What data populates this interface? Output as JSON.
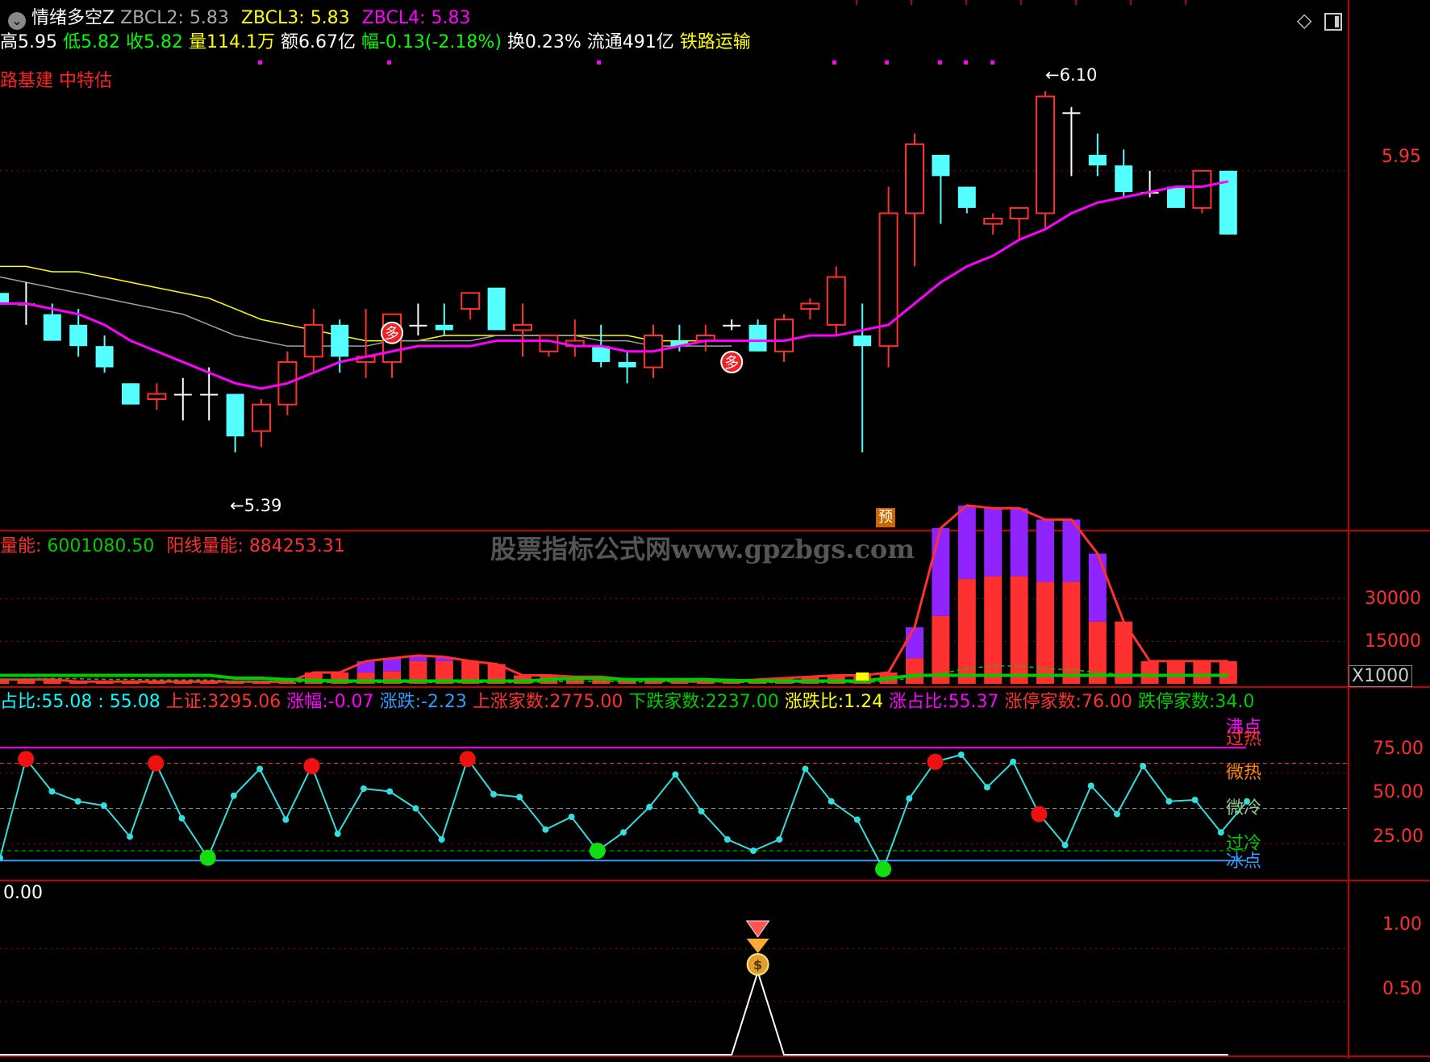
{
  "colors": {
    "up": "#ff3030",
    "down": "#54ffff",
    "ma_main": "#ff00ff",
    "ma_yellow": "#ffff00",
    "ma_gray": "#a0a0a0",
    "grid": "#b00000",
    "border": "#c00000",
    "green": "#00cc00",
    "purple": "#8f24ff",
    "cyan": "#00e5e5"
  },
  "header": {
    "indicator_name": "情绪多空Z",
    "zbcl2_label": "ZBCL2:",
    "zbcl2_value": "5.83",
    "zbcl3_label": "ZBCL3:",
    "zbcl3_value": "5.83",
    "zbcl4_label": "ZBCL4:",
    "zbcl4_value": "5.83",
    "high": "高5.95",
    "low": "低5.82",
    "close": "收5.82",
    "volume": "量114.1万",
    "amount": "额6.67亿",
    "change": "幅-0.13(-2.18%)",
    "turnover": "换0.23%",
    "float": "流通491亿",
    "sector": "铁路运输",
    "tags": "路基建 中特估",
    "collapse_icon": "chevron-down-icon",
    "diamond_icon": "diamond-icon",
    "window_icon": "window-toggle-icon"
  },
  "price_panel": {
    "y_axis_label": "5.95",
    "high_marker": "6.10",
    "low_marker": "5.39",
    "signal_label": "多",
    "forecast_label": "预"
  },
  "volume_panel": {
    "neg_label": "量能:",
    "neg_value": "6001080.50",
    "pos_label": "阳线量能:",
    "pos_value": "884253.31",
    "watermark": "股票指标公式网www.gpzbgs.com",
    "y_labels": [
      "30000",
      "15000"
    ],
    "multiplier": "X1000"
  },
  "sentiment_panel": {
    "ratio_label": "占比:",
    "ratio_value": "55.08",
    "ratio_value2": ": 55.08",
    "sh_label": "上证:",
    "sh_value": "3295.06",
    "chg_label": "涨幅:",
    "chg_value": "-0.07",
    "updown_label": "涨跌:",
    "updown_value": "-2.23",
    "up_count_label": "上涨家数:",
    "up_count_value": "2775.00",
    "down_count_label": "下跌家数:",
    "down_count_value": "2237.00",
    "ud_ratio_label": "涨跌比:",
    "ud_ratio_value": "1.24",
    "up_share_label": "涨占比:",
    "up_share_value": "55.37",
    "limit_up_label": "涨停家数:",
    "limit_up_value": "76.00",
    "limit_down_label": "跌停家数:",
    "limit_down_value": "34.0",
    "zone_labels": [
      "沸点",
      "过热",
      "微热",
      "微冷",
      "过冷",
      "冰点"
    ],
    "y_labels": [
      "75.00",
      "50.00",
      "25.00"
    ]
  },
  "signal_panel": {
    "value": "0.00",
    "y_labels": [
      "1.00",
      "0.50"
    ],
    "signal_icon": "money-bag-icon"
  },
  "chart_data": [
    {
      "type": "candlestick",
      "title": "情绪多空Z",
      "ylim": [
        5.3,
        6.15
      ],
      "candles": [
        [
          5.72,
          5.72,
          5.7,
          5.7
        ],
        [
          5.7,
          5.74,
          5.66,
          5.7
        ],
        [
          5.68,
          5.7,
          5.63,
          5.63
        ],
        [
          5.66,
          5.69,
          5.6,
          5.62
        ],
        [
          5.62,
          5.64,
          5.57,
          5.58
        ],
        [
          5.55,
          5.55,
          5.51,
          5.51
        ],
        [
          5.52,
          5.55,
          5.5,
          5.53
        ],
        [
          5.53,
          5.56,
          5.48,
          5.53
        ],
        [
          5.53,
          5.58,
          5.48,
          5.53
        ],
        [
          5.53,
          5.53,
          5.42,
          5.45
        ],
        [
          5.46,
          5.52,
          5.43,
          5.51
        ],
        [
          5.51,
          5.61,
          5.49,
          5.59
        ],
        [
          5.6,
          5.69,
          5.57,
          5.66
        ],
        [
          5.66,
          5.67,
          5.57,
          5.6
        ],
        [
          5.59,
          5.69,
          5.56,
          5.6
        ],
        [
          5.59,
          5.68,
          5.56,
          5.68
        ],
        [
          5.66,
          5.7,
          5.64,
          5.66
        ],
        [
          5.66,
          5.7,
          5.64,
          5.65
        ],
        [
          5.69,
          5.72,
          5.67,
          5.72
        ],
        [
          5.73,
          5.73,
          5.65,
          5.65
        ],
        [
          5.65,
          5.7,
          5.6,
          5.66
        ],
        [
          5.61,
          5.64,
          5.6,
          5.64
        ],
        [
          5.62,
          5.67,
          5.6,
          5.63
        ],
        [
          5.62,
          5.66,
          5.58,
          5.59
        ],
        [
          5.59,
          5.61,
          5.55,
          5.58
        ],
        [
          5.58,
          5.66,
          5.56,
          5.64
        ],
        [
          5.63,
          5.66,
          5.61,
          5.62
        ],
        [
          5.63,
          5.66,
          5.61,
          5.64
        ],
        [
          5.66,
          5.67,
          5.65,
          5.66
        ],
        [
          5.66,
          5.67,
          5.61,
          5.61
        ],
        [
          5.61,
          5.68,
          5.59,
          5.67
        ],
        [
          5.69,
          5.71,
          5.67,
          5.7
        ],
        [
          5.66,
          5.77,
          5.64,
          5.75
        ],
        [
          5.64,
          5.7,
          5.42,
          5.62
        ],
        [
          5.62,
          5.92,
          5.58,
          5.87
        ],
        [
          5.87,
          6.02,
          5.77,
          6.0
        ],
        [
          5.98,
          5.98,
          5.85,
          5.94
        ],
        [
          5.92,
          5.92,
          5.87,
          5.88
        ],
        [
          5.85,
          5.87,
          5.83,
          5.86
        ],
        [
          5.86,
          5.88,
          5.82,
          5.88
        ],
        [
          5.87,
          6.1,
          5.84,
          6.09
        ],
        [
          6.06,
          6.07,
          5.94,
          6.06
        ],
        [
          5.98,
          6.02,
          5.94,
          5.96
        ],
        [
          5.96,
          5.99,
          5.9,
          5.91
        ],
        [
          5.91,
          5.95,
          5.9,
          5.91
        ],
        [
          5.92,
          5.92,
          5.9,
          5.88
        ],
        [
          5.88,
          5.95,
          5.87,
          5.95
        ],
        [
          5.95,
          5.95,
          5.83,
          5.83
        ]
      ],
      "ma_main": [
        5.7,
        5.7,
        5.69,
        5.68,
        5.66,
        5.63,
        5.61,
        5.59,
        5.57,
        5.55,
        5.54,
        5.55,
        5.57,
        5.59,
        5.6,
        5.61,
        5.62,
        5.62,
        5.62,
        5.63,
        5.63,
        5.63,
        5.62,
        5.62,
        5.61,
        5.61,
        5.62,
        5.63,
        5.63,
        5.63,
        5.63,
        5.64,
        5.64,
        5.65,
        5.66,
        5.7,
        5.74,
        5.77,
        5.79,
        5.82,
        5.84,
        5.87,
        5.89,
        5.9,
        5.91,
        5.92,
        5.92,
        5.93
      ],
      "ma_gray": [
        5.75,
        5.74,
        5.73,
        5.72,
        5.71,
        5.7,
        5.69,
        5.68,
        5.66,
        5.64,
        5.63,
        5.62,
        5.62,
        5.62,
        5.62,
        5.63,
        5.63,
        5.63,
        5.63,
        5.64,
        5.64,
        5.64,
        5.64,
        5.63,
        5.63,
        5.62,
        5.62,
        5.62,
        5.62
      ],
      "ma_yellow": [
        5.77,
        5.77,
        5.76,
        5.76,
        5.75,
        5.74,
        5.73,
        5.72,
        5.71,
        5.69,
        5.67,
        5.66,
        5.65,
        5.64,
        5.63,
        5.63,
        5.63,
        5.64,
        5.64,
        5.64,
        5.64,
        5.64,
        5.64,
        5.64,
        5.64,
        5.63,
        5.63,
        5.63,
        5.63
      ],
      "signals": [
        {
          "index": 15,
          "label": "多"
        },
        {
          "index": 28,
          "label": "多"
        }
      ]
    },
    {
      "type": "bar",
      "title": "量能",
      "ylim": [
        0,
        45000
      ],
      "red": [
        1500,
        1500,
        1500,
        800,
        800,
        800,
        800,
        800,
        800,
        800,
        800,
        600,
        4000,
        4000,
        4000,
        4500,
        8000,
        8000,
        8000,
        7000,
        3000,
        3000,
        2500,
        2500,
        1500,
        1500,
        800,
        800,
        1000,
        1500,
        2000,
        2500,
        3000,
        3000,
        4000,
        9000,
        24000,
        37000,
        38000,
        38000,
        36000,
        36000,
        22000,
        22000,
        8000,
        8000,
        8000,
        8000
      ],
      "purple": [
        0,
        0,
        0,
        0,
        0,
        0,
        0,
        0,
        0,
        0,
        0,
        0,
        0,
        0,
        4000,
        4500,
        2000,
        1500,
        0,
        0,
        0,
        0,
        0,
        0,
        0,
        0,
        0,
        0,
        0,
        0,
        0,
        0,
        0,
        0,
        0,
        11000,
        31000,
        26000,
        24000,
        24000,
        22000,
        22000,
        24000,
        0,
        0,
        0,
        0,
        0
      ],
      "green": [
        3000,
        3500,
        4000,
        4000,
        3500,
        3500,
        3000,
        3000,
        3000,
        2000,
        2000,
        1500,
        1200,
        1000,
        1000,
        1000,
        1000,
        1000,
        1000,
        1000,
        1000,
        1500,
        2000,
        2000,
        1500,
        1500,
        1500,
        1500,
        1200,
        1000,
        1000,
        1000,
        1000,
        1000,
        2000,
        5000,
        8000,
        12000,
        14000,
        14000,
        12000,
        11000,
        9000,
        7000,
        6000,
        6000,
        6000,
        6000
      ]
    },
    {
      "type": "line",
      "title": "情绪",
      "ylim": [
        0,
        100
      ],
      "values": [
        15,
        85,
        62,
        55,
        52,
        30,
        82,
        43,
        15,
        59,
        78,
        42,
        80,
        32,
        64,
        62,
        50,
        28,
        85,
        60,
        58,
        35,
        44,
        20,
        33,
        51,
        74,
        48,
        28,
        20,
        28,
        78,
        55,
        42,
        7,
        57,
        83,
        88,
        65,
        83,
        46,
        24,
        66,
        46,
        80,
        55,
        56,
        33,
        55
      ],
      "red_dots": [
        1,
        6,
        12,
        18,
        36,
        40
      ],
      "green_dots": [
        8,
        23,
        34
      ]
    },
    {
      "type": "line",
      "title": "0.00",
      "ylim": [
        0,
        1.2
      ],
      "values": [
        0,
        0,
        0,
        0,
        0,
        0,
        0,
        0,
        0,
        0,
        0,
        0,
        0,
        0,
        0,
        0,
        0,
        0,
        0,
        0,
        0,
        0,
        0,
        0,
        0,
        0,
        0,
        0,
        0,
        1,
        0,
        0,
        0,
        0,
        0,
        0,
        0,
        0,
        0,
        0,
        0,
        0,
        0,
        0,
        0,
        0,
        0,
        0
      ]
    }
  ]
}
